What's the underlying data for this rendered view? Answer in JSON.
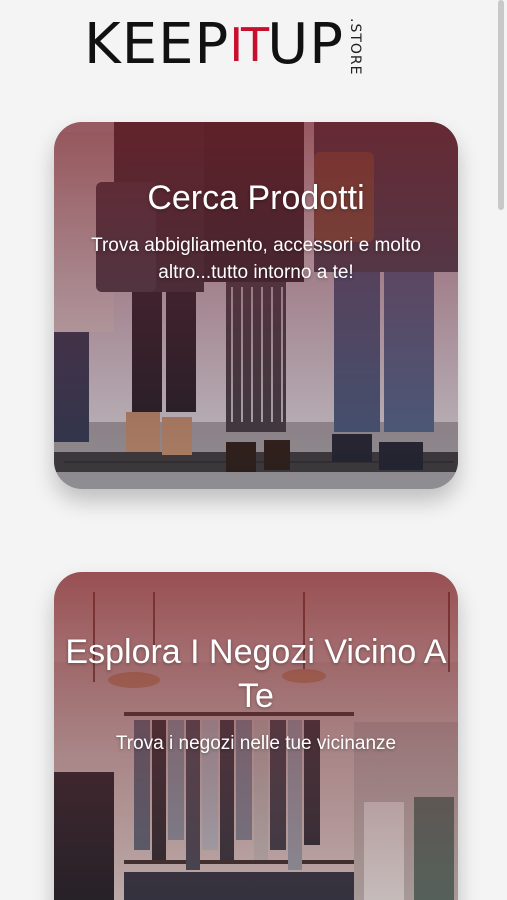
{
  "header": {
    "logo": {
      "keep": "KEEP",
      "it": "IT",
      "up": "UP",
      "store": ".STORE"
    }
  },
  "colors": {
    "brand_red": "#c8102e",
    "background": "#f4f4f4",
    "text_dark": "#111111"
  },
  "cards": [
    {
      "title": "Cerca Prodotti",
      "subtitle": "Trova abbigliamento, accessori e molto altro...tutto intorno a te!",
      "image": "people-shopping-bags-photo"
    },
    {
      "title": "Esplora I Negozi Vicino A Te",
      "subtitle": "Trova i negozi nelle tue vicinanze",
      "image": "clothing-store-interior-photo"
    }
  ]
}
